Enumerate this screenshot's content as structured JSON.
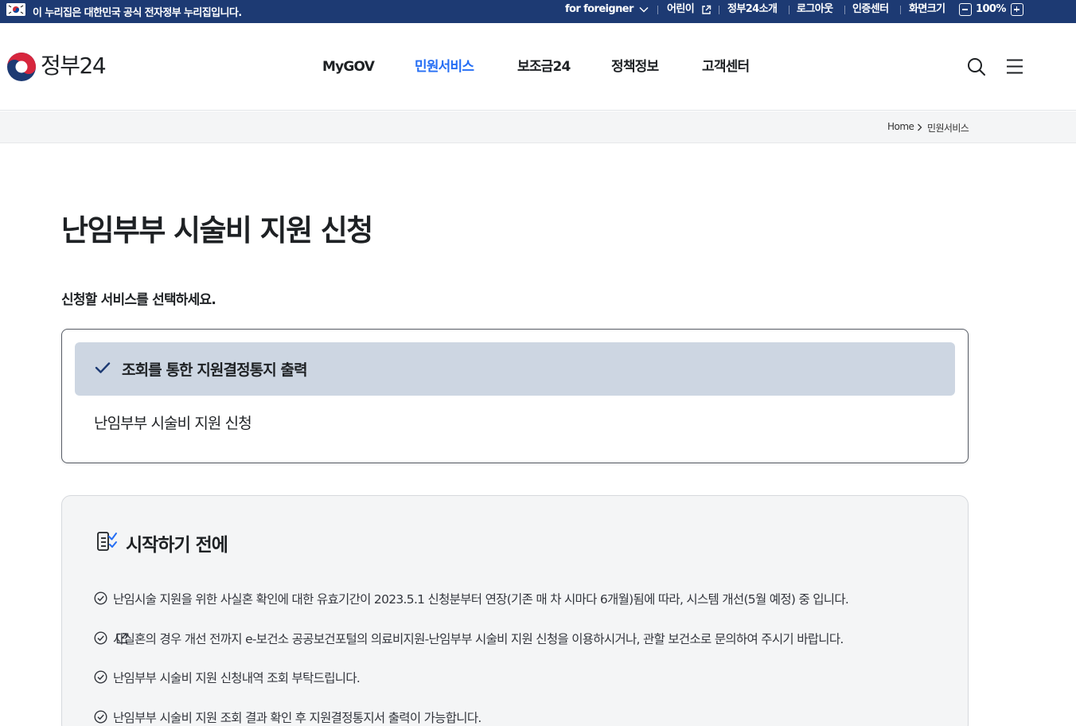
{
  "topbar": {
    "gov_notice": "이 누리집은 대한민국 공식 전자정부 누리집입니다.",
    "for_foreigner": "for foreigner",
    "kids": "어린이",
    "about": "정부24소개",
    "logout": "로그아웃",
    "cert_center": "인증센터",
    "zoom_label": "화면크기",
    "zoom_value": "100%"
  },
  "header": {
    "logo_text": "정부24",
    "nav": [
      {
        "label": "MyGOV"
      },
      {
        "label": "민원서비스",
        "active": true
      },
      {
        "label": "보조금24"
      },
      {
        "label": "정책정보"
      },
      {
        "label": "고객센터"
      }
    ]
  },
  "breadcrumb": {
    "home": "Home",
    "current": "민원서비스"
  },
  "main": {
    "title": "난임부부 시술비 지원 신청",
    "prompt": "신청할 서비스를 선택하세요.",
    "options": [
      {
        "label": "조회를 통한 지원결정통지 출력",
        "selected": true
      },
      {
        "label": "난임부부 시술비 지원 신청",
        "selected": false
      }
    ],
    "notice": {
      "title": "시작하기 전에",
      "items": [
        {
          "text": "난임시술 지원을 위한 사실혼 확인에 대한 유효기간이 2023.5.1 신청분부터 연장(기존 매 차 시마다 6개월)됨에 따라, 시스템 개선(5월 예정) 중 입니다."
        },
        {
          "text_before": "사실혼의 경우 개선 전까지 e-보건소 공공보건포털",
          "text_after": "의 의료비지원-난임부부 시술비 지원 신청을 이용하시거나, 관할 보건소로 문의하여 주시기 바랍니다."
        },
        {
          "text": "난임부부 시술비 지원 신청내역 조회 부탁드립니다."
        },
        {
          "text": "난임부부 시술비 지원 조회 결과 확인 후 지원결정통지서 출력이 가능합니다."
        }
      ]
    }
  },
  "colors": {
    "topbar_bg": "#1d3a73",
    "nav_active": "#256ef4",
    "selected_option_bg": "#cdd6e2",
    "notice_bg": "#f4f5f6"
  },
  "icons": {
    "flag": "korea-flag-icon",
    "dropdown": "chevron-down-icon",
    "external": "external-link-icon",
    "zoom_out": "minus-icon",
    "zoom_in": "plus-icon",
    "search": "search-icon",
    "menu": "hamburger-menu-icon",
    "check": "check-icon",
    "checklist": "checklist-icon",
    "circle_check": "circle-check-icon"
  }
}
